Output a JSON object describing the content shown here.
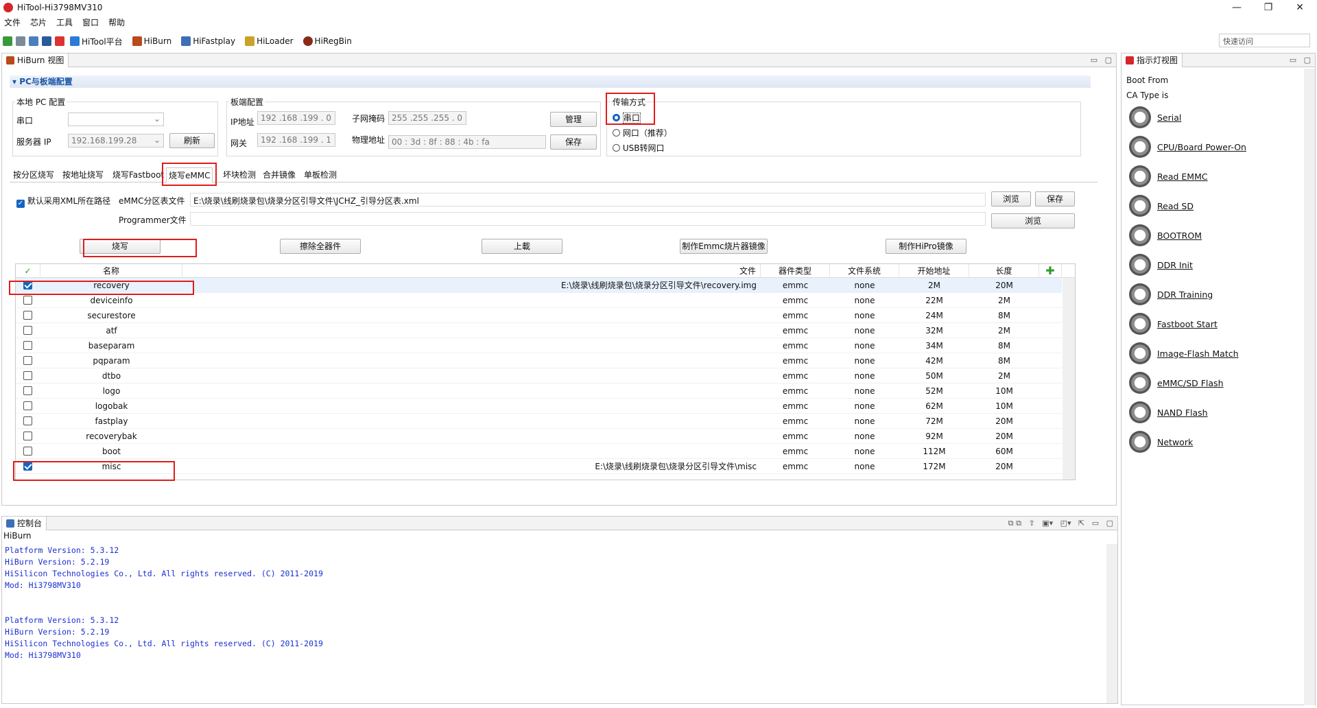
{
  "window": {
    "title": "HiTool-Hi3798MV310",
    "minimize": "—",
    "maximize": "❐",
    "close": "✕"
  },
  "menu": [
    "文件",
    "芯片",
    "工具",
    "窗口",
    "帮助"
  ],
  "toolbar": {
    "items": [
      {
        "label": "HiTool平台",
        "icon": "home-icon",
        "color": "#2a7bd6"
      },
      {
        "label": "HiBurn",
        "icon": "burn-icon",
        "color": "#b84a1b"
      },
      {
        "label": "HiFastplay",
        "icon": "fastplay-icon",
        "color": "#3d6fb6"
      },
      {
        "label": "HiLoader",
        "icon": "loader-icon",
        "color": "#c9a227"
      },
      {
        "label": "HiRegBin",
        "icon": "regbin-icon",
        "color": "#8a2a1a"
      }
    ],
    "quick_access": "快速访问"
  },
  "hiburn": {
    "tab": "HiBurn 视图",
    "section_title": "PC与板端配置",
    "local_pc": {
      "title": "本地 PC 配置",
      "serial_label": "串口",
      "serial_value": "",
      "server_ip_label": "服务器 IP",
      "server_ip_value": "192.168.199.28",
      "refresh": "刷新"
    },
    "board": {
      "title": "板端配置",
      "ip_label": "IP地址",
      "ip_value": "192 .168 .199 . 0",
      "mask_label": "子网掩码",
      "mask_value": "255 .255 .255 . 0",
      "gateway_label": "网关",
      "gateway_value": "192 .168 .199 . 1",
      "mac_label": "物理地址",
      "mac_value": "00 : 3d : 8f : 88 : 4b : fa",
      "manage": "管理",
      "save": "保存"
    },
    "transfer": {
      "title": "传输方式",
      "options": [
        "串口",
        "网口（推荐）",
        "USB转网口"
      ],
      "selected": "串口"
    },
    "tabs": [
      "按分区烧写",
      "按地址烧写",
      "烧写Fastboot",
      "烧写eMMC",
      "坏块检测",
      "合并镜像",
      "单板检测"
    ],
    "active_tab": "烧写eMMC",
    "xml": {
      "checkbox_label": "默认采用XML所在路径",
      "emmc_label": "eMMC分区表文件",
      "emmc_value": "E:\\烧录\\线刷烧录包\\烧录分区引导文件\\JCHZ_引导分区表.xml",
      "browse": "浏览",
      "save": "保存",
      "programmer_label": "Programmer文件",
      "programmer_value": "",
      "browse2": "浏览"
    },
    "actions": [
      "烧写",
      "擦除全器件",
      "上載",
      "制作Emmc烧片器镜像",
      "制作HiPro镜像"
    ],
    "columns": [
      "名称",
      "文件",
      "器件类型",
      "文件系统",
      "开始地址",
      "长度"
    ],
    "rows": [
      {
        "name": "recovery",
        "file": "E:\\烧录\\线刷烧录包\\烧录分区引导文件\\recovery.img",
        "type": "emmc",
        "fs": "none",
        "start": "2M",
        "length": "20M",
        "checked": true
      },
      {
        "name": "deviceinfo",
        "file": "",
        "type": "emmc",
        "fs": "none",
        "start": "22M",
        "length": "2M",
        "checked": false
      },
      {
        "name": "securestore",
        "file": "",
        "type": "emmc",
        "fs": "none",
        "start": "24M",
        "length": "8M",
        "checked": false
      },
      {
        "name": "atf",
        "file": "",
        "type": "emmc",
        "fs": "none",
        "start": "32M",
        "length": "2M",
        "checked": false
      },
      {
        "name": "baseparam",
        "file": "",
        "type": "emmc",
        "fs": "none",
        "start": "34M",
        "length": "8M",
        "checked": false
      },
      {
        "name": "pqparam",
        "file": "",
        "type": "emmc",
        "fs": "none",
        "start": "42M",
        "length": "8M",
        "checked": false
      },
      {
        "name": "dtbo",
        "file": "",
        "type": "emmc",
        "fs": "none",
        "start": "50M",
        "length": "2M",
        "checked": false
      },
      {
        "name": "logo",
        "file": "",
        "type": "emmc",
        "fs": "none",
        "start": "52M",
        "length": "10M",
        "checked": false
      },
      {
        "name": "logobak",
        "file": "",
        "type": "emmc",
        "fs": "none",
        "start": "62M",
        "length": "10M",
        "checked": false
      },
      {
        "name": "fastplay",
        "file": "",
        "type": "emmc",
        "fs": "none",
        "start": "72M",
        "length": "20M",
        "checked": false
      },
      {
        "name": "recoverybak",
        "file": "",
        "type": "emmc",
        "fs": "none",
        "start": "92M",
        "length": "20M",
        "checked": false
      },
      {
        "name": "boot",
        "file": "",
        "type": "emmc",
        "fs": "none",
        "start": "112M",
        "length": "60M",
        "checked": false
      },
      {
        "name": "misc",
        "file": "E:\\烧录\\线刷烧录包\\烧录分区引导文件\\misc",
        "type": "emmc",
        "fs": "none",
        "start": "172M",
        "length": "20M",
        "checked": true
      }
    ]
  },
  "console": {
    "tab": "控制台",
    "source": "HiBurn",
    "lines": [
      "Platform Version: 5.3.12",
      "HiBurn Version: 5.2.19",
      "HiSilicon Technologies Co., Ltd. All rights reserved. (C) 2011-2019",
      "Mod: Hi3798MV310",
      "",
      "",
      "Platform Version: 5.3.12",
      "HiBurn Version: 5.2.19",
      "HiSilicon Technologies Co., Ltd. All rights reserved. (C) 2011-2019",
      "Mod: Hi3798MV310"
    ]
  },
  "indicator": {
    "tab": "指示灯视图",
    "boot_from": "Boot From",
    "ca_type": "CA Type is",
    "items": [
      "Serial",
      "CPU/Board Power-On",
      "Read EMMC",
      "Read SD",
      "BOOTROM",
      "DDR Init",
      "DDR Training",
      "Fastboot Start",
      "Image-Flash Match",
      "eMMC/SD Flash",
      "NAND Flash",
      "Network"
    ]
  },
  "colors": {
    "highlight": "#e01b1b",
    "accent": "#1565c0",
    "console_text": "#1a2fd1"
  }
}
